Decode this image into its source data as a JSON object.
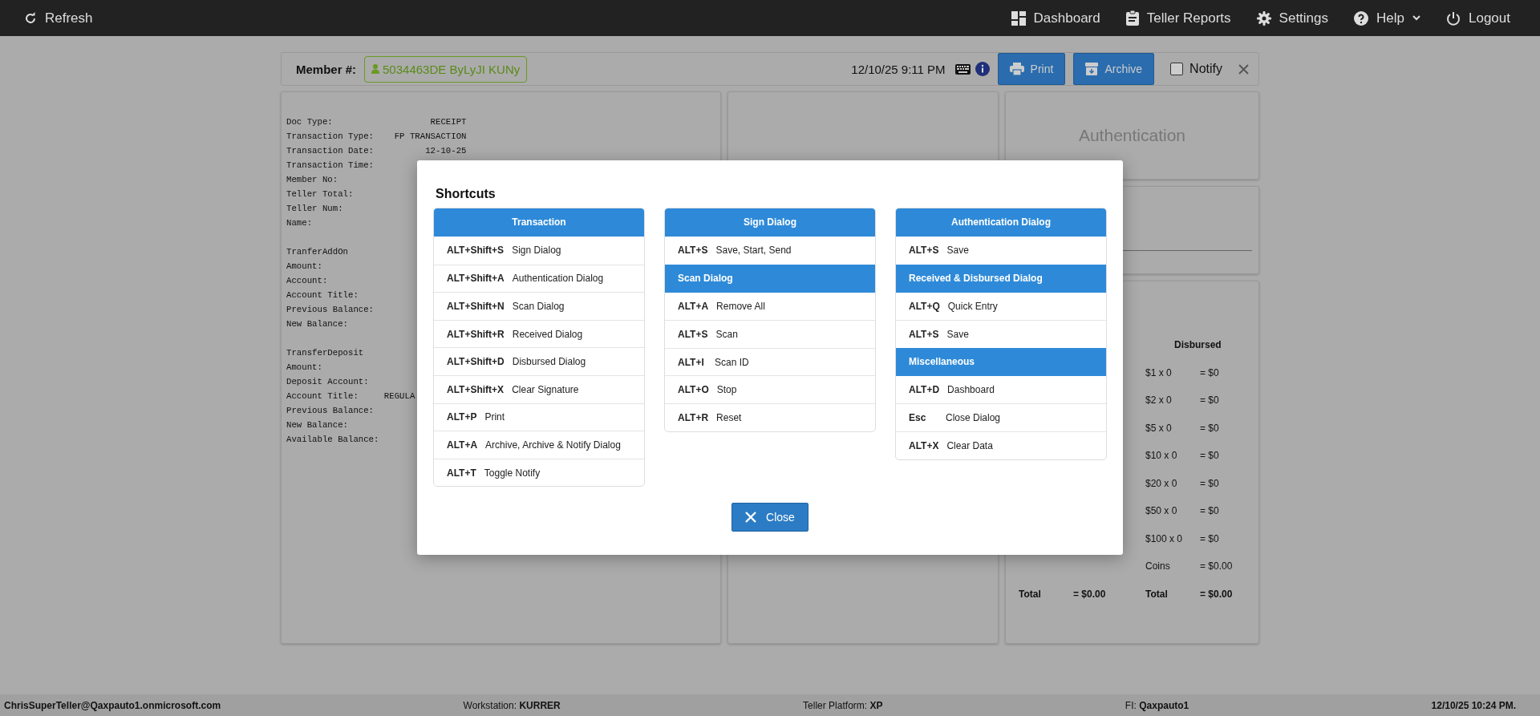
{
  "topbar": {
    "refresh": "Refresh",
    "items": [
      {
        "kind": "dashboard",
        "label": "Dashboard"
      },
      {
        "kind": "reports",
        "label": "Teller Reports"
      },
      {
        "kind": "settings",
        "label": "Settings"
      },
      {
        "kind": "help",
        "label": "Help"
      },
      {
        "kind": "logout",
        "label": "Logout"
      }
    ]
  },
  "header": {
    "member_label": "Member #:",
    "member_value": "5034463DE ByLyJI KUNy",
    "datetime": "12/10/25 9:11 PM",
    "print": "Print",
    "archive": "Archive",
    "notify": {
      "label": "Notify",
      "checked": false
    }
  },
  "receipt": [
    [
      "Doc Type:                   RECEIPT",
      "Transaction Type:    FP TRANSACTION",
      "Transaction Date:          12-10-25",
      "Transaction Time:",
      "Member No:",
      "Teller Total:",
      "Teller Num:",
      "Name:"
    ],
    [
      "TranferAddOn",
      "Amount:",
      "Account:",
      "Account Title:",
      "Previous Balance:",
      "New Balance:"
    ],
    [
      "TransferDeposit",
      "Amount:",
      "Deposit Account:",
      "Account Title:     REGULA",
      "Previous Balance:",
      "New Balance:",
      "Available Balance:"
    ]
  ],
  "authentication": "Authentication",
  "cash": {
    "disbursed_header": "Disbursed",
    "disbursed_rows": [
      {
        "label": "$1 x 0",
        "value": "= $0"
      },
      {
        "label": "$2 x 0",
        "value": "= $0"
      },
      {
        "label": "$5 x 0",
        "value": "= $0"
      },
      {
        "label": "$10 x 0",
        "value": "= $0"
      },
      {
        "label": "$20 x 0",
        "value": "= $0"
      },
      {
        "label": "$50 x 0",
        "value": "= $0"
      },
      {
        "label": "$100 x 0",
        "value": "= $0"
      },
      {
        "label": "Coins",
        "value": "= $0.00"
      }
    ],
    "received_total": {
      "label": "Total",
      "value": "= $0.00"
    },
    "disbursed_total": {
      "label": "Total",
      "value": "= $0.00"
    }
  },
  "dialog": {
    "title": "Shortcuts",
    "columns": [
      [
        {
          "title": "Transaction",
          "rows": [
            {
              "key": "ALT+Shift+S",
              "action": "Sign Dialog"
            },
            {
              "key": "ALT+Shift+A",
              "action": "Authentication Dialog"
            },
            {
              "key": "ALT+Shift+N",
              "action": "Scan Dialog"
            },
            {
              "key": "ALT+Shift+R",
              "action": "Received Dialog"
            },
            {
              "key": "ALT+Shift+D",
              "action": "Disbursed Dialog"
            },
            {
              "key": "ALT+Shift+X",
              "action": "Clear Signature"
            },
            {
              "key": "ALT+P",
              "action": "Print"
            },
            {
              "key": "ALT+A",
              "action": "Archive, Archive & Notify Dialog"
            },
            {
              "key": "ALT+T",
              "action": "Toggle Notify"
            }
          ]
        }
      ],
      [
        {
          "title": "Sign Dialog",
          "rows": [
            {
              "key": "ALT+S",
              "action": "Save, Start, Send"
            }
          ]
        },
        {
          "title": "Scan Dialog",
          "rows": [
            {
              "key": "ALT+A",
              "action": "Remove All"
            },
            {
              "key": "ALT+S",
              "action": "Scan"
            },
            {
              "key": "ALT+I",
              "action": "Scan ID"
            },
            {
              "key": "ALT+O",
              "action": "Stop"
            },
            {
              "key": "ALT+R",
              "action": "Reset"
            }
          ]
        }
      ],
      [
        {
          "title": "Authentication Dialog",
          "rows": [
            {
              "key": "ALT+S",
              "action": "Save"
            }
          ]
        },
        {
          "title": "Received & Disbursed Dialog",
          "rows": [
            {
              "key": "ALT+Q",
              "action": "Quick Entry"
            },
            {
              "key": "ALT+S",
              "action": "Save"
            }
          ]
        },
        {
          "title": "Miscellaneous",
          "rows": [
            {
              "key": "ALT+D",
              "action": "Dashboard"
            },
            {
              "key": "Esc",
              "action": "Close Dialog"
            },
            {
              "key": "ALT+X",
              "action": "Clear Data"
            }
          ]
        }
      ]
    ],
    "close": "Close"
  },
  "status_bar": {
    "user": "ChrisSuperTeller@Qaxpauto1.onmicrosoft.com",
    "workstation": "Workstation: **KURRER**",
    "platform": "Teller Platform: **XP**",
    "fi": "FI: **Qaxpauto1**",
    "datetime": "12/10/25 10:24 PM."
  }
}
